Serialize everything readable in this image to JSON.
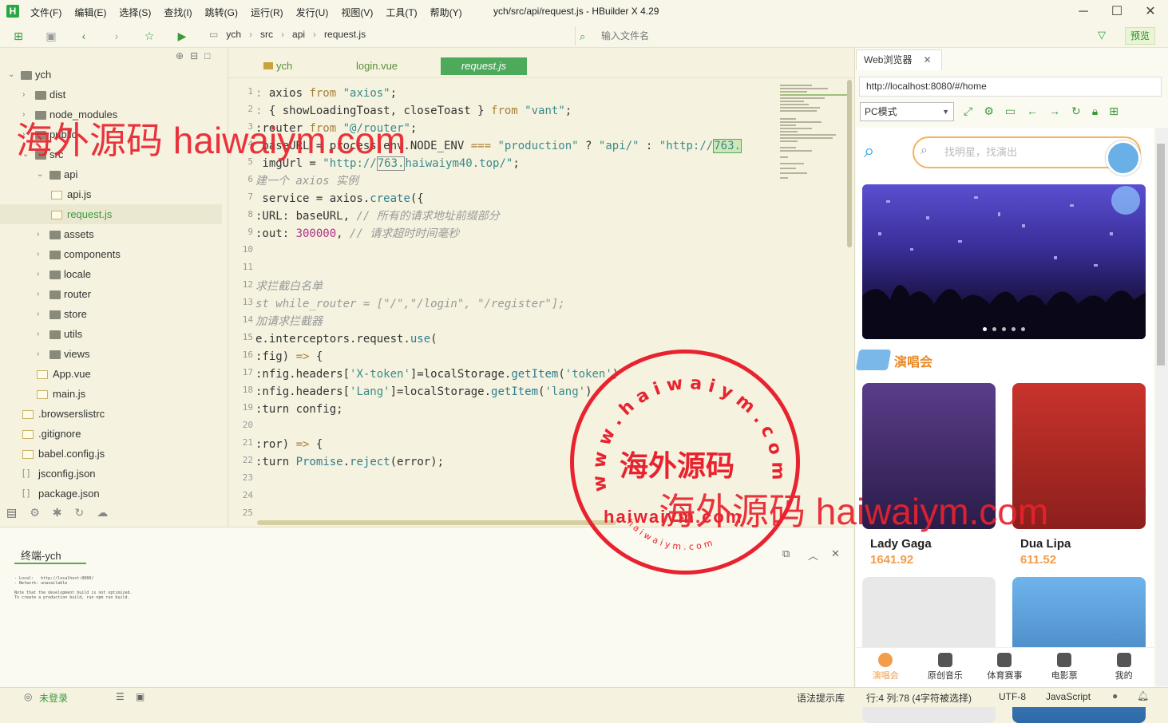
{
  "app": {
    "title": "ych/src/api/request.js - HBuilder X 4.29",
    "logo": "H",
    "menu": [
      "文件(F)",
      "编辑(E)",
      "选择(S)",
      "查找(I)",
      "跳转(G)",
      "运行(R)",
      "发行(U)",
      "视图(V)",
      "工具(T)",
      "帮助(Y)"
    ]
  },
  "toolbar": {
    "breadcrumb": [
      "ych",
      "src",
      "api",
      "request.js"
    ],
    "file_search_placeholder": "输入文件名",
    "preview_label": "预览"
  },
  "sidebar": {
    "items": [
      {
        "label": "ych",
        "type": "folder",
        "open": true
      },
      {
        "label": "dist",
        "type": "folder"
      },
      {
        "label": "node_modules",
        "type": "folder"
      },
      {
        "label": "public",
        "type": "folder"
      },
      {
        "label": "src",
        "type": "folder",
        "open": true
      },
      {
        "label": "api",
        "type": "folder",
        "open": true
      },
      {
        "label": "api.js",
        "type": "file"
      },
      {
        "label": "request.js",
        "type": "file",
        "selected": true
      },
      {
        "label": "assets",
        "type": "folder"
      },
      {
        "label": "components",
        "type": "folder"
      },
      {
        "label": "locale",
        "type": "folder"
      },
      {
        "label": "router",
        "type": "folder"
      },
      {
        "label": "store",
        "type": "folder"
      },
      {
        "label": "utils",
        "type": "folder"
      },
      {
        "label": "views",
        "type": "folder"
      },
      {
        "label": "App.vue",
        "type": "file"
      },
      {
        "label": "main.js",
        "type": "file"
      },
      {
        "label": ".browserslistrc",
        "type": "file"
      },
      {
        "label": ".gitignore",
        "type": "file"
      },
      {
        "label": "babel.config.js",
        "type": "file"
      },
      {
        "label": "jsconfig.json",
        "type": "json"
      },
      {
        "label": "package.json",
        "type": "json"
      }
    ]
  },
  "editor": {
    "tabs": [
      "ych",
      "login.vue",
      "request.js"
    ],
    "active_tab": "request.js",
    "line_numbers": [
      "1",
      "2",
      "3",
      "4",
      "5",
      "6",
      "7",
      "8",
      "9",
      "10",
      "11",
      "12",
      "13",
      "14",
      "15",
      "16",
      "17",
      "18",
      "19",
      "20",
      "21",
      "22",
      "23",
      "24",
      "25"
    ]
  },
  "terminal": {
    "tab": "终端-ych",
    "output": "- Local:   http://localhost:8080/\n- Network: unavailable\n\nNote that the development build is not optimized.\nTo create a production build, run npm run build."
  },
  "browser": {
    "tab": "Web浏览器",
    "url": "http://localhost:8080/#/home",
    "mode": "PC模式",
    "search_placeholder": "找明星，找演出",
    "section_title": "演唱会",
    "cards": [
      {
        "name": "Lady Gaga",
        "value": "1641.92"
      },
      {
        "name": "Dua Lipa",
        "value": "611.52"
      }
    ],
    "nav": [
      "演唱会",
      "原创音乐",
      "体育赛事",
      "电影票",
      "我的"
    ]
  },
  "status": {
    "login": "未登录",
    "hint": "语法提示库",
    "position": "行:4  列:78 (4字符被选择)",
    "encoding": "UTF-8",
    "language": "JavaScript"
  },
  "watermark": {
    "text1": "海外源码 haiwaiym.com",
    "text2": "海外源码 haiwaiym.com",
    "stamp_center": "海外源码",
    "stamp_url": "haiwaiym.com",
    "stamp_ring_top": "w w w . h a i w a i y m . c o m",
    "stamp_ring_bottom": "h a i w a i y m . c o m"
  }
}
